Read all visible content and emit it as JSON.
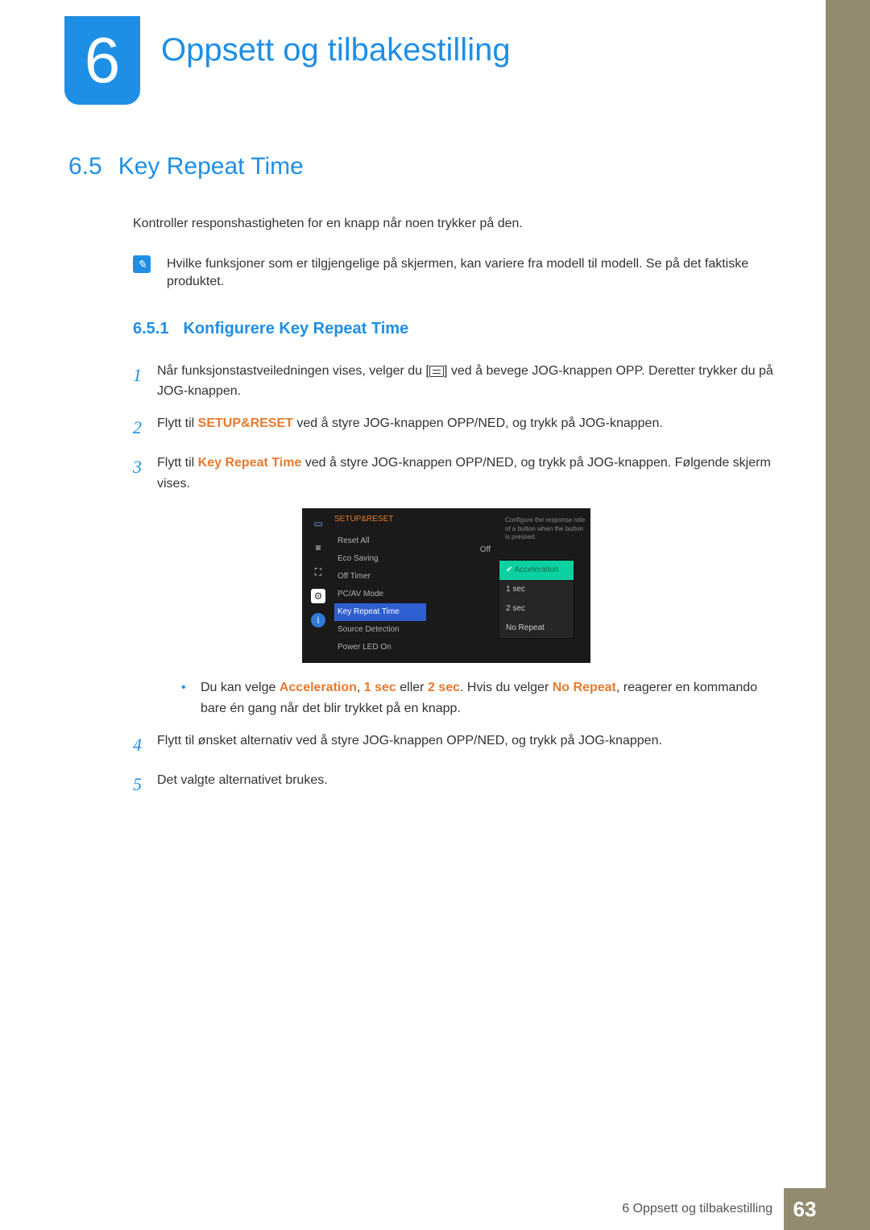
{
  "chapter": {
    "number": "6",
    "title": "Oppsett og tilbakestilling"
  },
  "section": {
    "number": "6.5",
    "title": "Key Repeat Time"
  },
  "intro": "Kontroller responshastigheten for en knapp når noen trykker på den.",
  "note": "Hvilke funksjoner som er tilgjengelige på skjermen, kan variere fra modell til modell. Se på det faktiske produktet.",
  "subsection": {
    "number": "6.5.1",
    "title": "Konfigurere Key Repeat Time"
  },
  "steps": {
    "s1a": "Når funksjonstastveiledningen vises, velger du [",
    "s1b": "] ved å bevege JOG-knappen OPP. Deretter trykker du på JOG-knappen.",
    "s2a": "Flytt til ",
    "s2b": "SETUP&RESET",
    "s2c": " ved å styre JOG-knappen OPP/NED, og trykk på JOG-knappen.",
    "s3a": "Flytt til ",
    "s3b": "Key Repeat Time",
    "s3c": " ved å styre JOG-knappen OPP/NED, og trykk på JOG-knappen. Følgende skjerm vises.",
    "bubullet_a": "Du kan velge ",
    "opt_accel": "Acceleration",
    "comma1": ", ",
    "opt_1s": "1 sec",
    "or_word": " eller ",
    "opt_2s": "2 sec",
    "bubullet_b": ". Hvis du velger ",
    "opt_nr": "No Repeat",
    "bubullet_c": ", reagerer en kommando bare én gang når det blir trykket på en knapp.",
    "s4": "Flytt til ønsket alternativ ved å styre JOG-knappen OPP/NED, og trykk på JOG-knappen.",
    "s5": "Det valgte alternativet brukes."
  },
  "step_numbers": {
    "n1": "1",
    "n2": "2",
    "n3": "3",
    "n4": "4",
    "n5": "5"
  },
  "osd": {
    "header": "SETUP&RESET",
    "items": [
      "Reset All",
      "Eco Saving",
      "Off Timer",
      "PC/AV Mode",
      "Key Repeat Time",
      "Source Detection",
      "Power LED On"
    ],
    "eco_value": "Off",
    "options": [
      "Acceleration",
      "1 sec",
      "2 sec",
      "No Repeat"
    ],
    "desc": "Configure the response rate of a button when the button is pressed."
  },
  "footer": {
    "pagelabel": "6 Oppsett og tilbakestilling",
    "pagenum": "63"
  }
}
